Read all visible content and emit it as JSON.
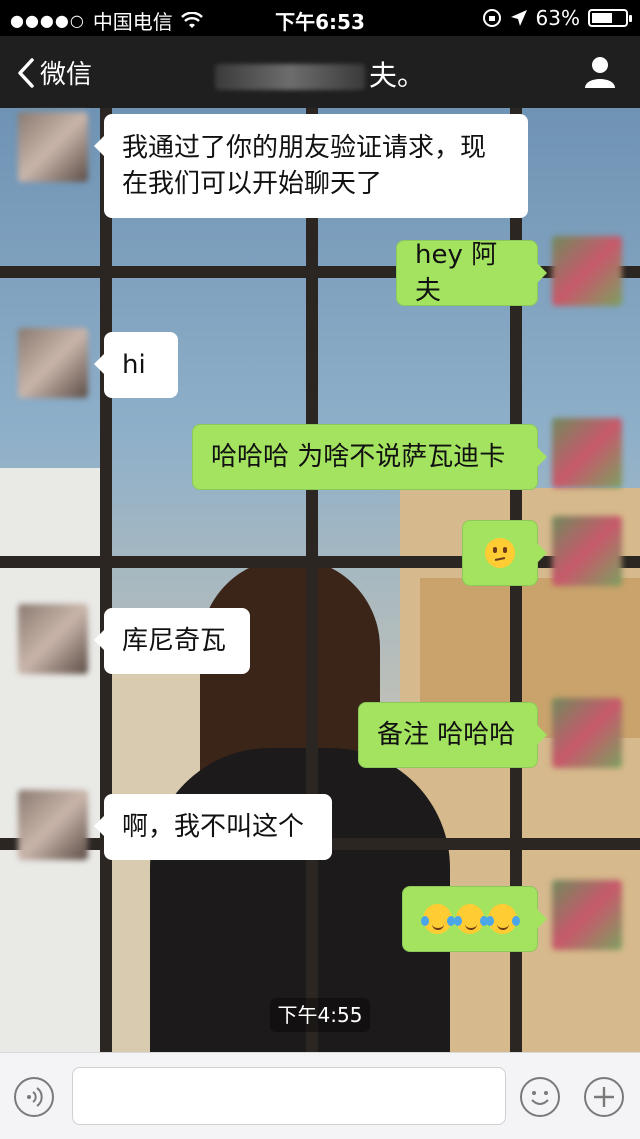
{
  "status_bar": {
    "signal": "●●●●○",
    "carrier": "中国电信",
    "time": "下午6:53",
    "battery": "63%",
    "battery_level": 0.63
  },
  "nav": {
    "back_label": "微信",
    "title_suffix": "夫。"
  },
  "messages": [
    {
      "side": "in",
      "text_line1": "我通过了你的朋友验证请求，现",
      "text_line2": "在我们可以开始聊天了"
    },
    {
      "side": "out",
      "text": "hey 阿夫"
    },
    {
      "side": "in",
      "text": "hi"
    },
    {
      "side": "out",
      "text": "哈哈哈 为啥不说萨瓦迪卡"
    },
    {
      "side": "out",
      "emoji": "confused-face-emoji"
    },
    {
      "side": "in",
      "text": "库尼奇瓦"
    },
    {
      "side": "out",
      "text": "备注 哈哈哈"
    },
    {
      "side": "in",
      "text": "啊，我不叫这个"
    },
    {
      "side": "out",
      "emoji": "crying-laughing-emoji x3"
    }
  ],
  "timestamp": "下午4:55",
  "colors": {
    "out_bubble": "#a3e360",
    "in_bubble": "#ffffff",
    "nav_bg": "#1f1f1f"
  }
}
